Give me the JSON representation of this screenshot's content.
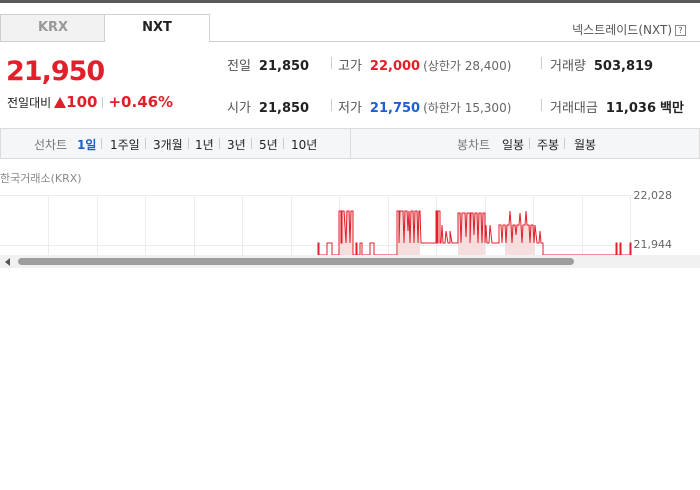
{
  "tabs": [
    {
      "label": "KRX",
      "active": false
    },
    {
      "label": "NXT",
      "active": true
    }
  ],
  "nxt_link": {
    "label": "넥스트레이드(NXT)",
    "help_icon": "question-box-icon",
    "help_glyph": "?"
  },
  "quote": {
    "price": "21,950",
    "change_label": "전일대비",
    "change_value": "100",
    "change_percent": "+0.46%",
    "direction": "up"
  },
  "stats": {
    "prev_close": {
      "label": "전일",
      "value": "21,850"
    },
    "open": {
      "label": "시가",
      "value": "21,850"
    },
    "high": {
      "label": "고가",
      "value": "22,000",
      "sub": "(상한가 28,400)"
    },
    "low": {
      "label": "저가",
      "value": "21,750",
      "sub": "(하한가 15,300)"
    },
    "volume": {
      "label": "거래량",
      "value": "503,819"
    },
    "amount": {
      "label": "거래대금",
      "value": "11,036",
      "unit": "백만"
    }
  },
  "period_bar": {
    "line_label": "선차트",
    "line_options": [
      "1일",
      "1주일",
      "3개월",
      "1년",
      "3년",
      "5년",
      "10년"
    ],
    "selected": "1일",
    "candle_label": "봉차트",
    "candle_options": [
      "일봉",
      "주봉",
      "월봉"
    ]
  },
  "chart": {
    "exchange_label": "한국거래소(KRX)",
    "y_ticks": [
      "22,028",
      "21,944"
    ]
  },
  "colors": {
    "up": "#e0202a",
    "down": "#1b5fd1",
    "accent_blue": "#1b5fd1"
  }
}
